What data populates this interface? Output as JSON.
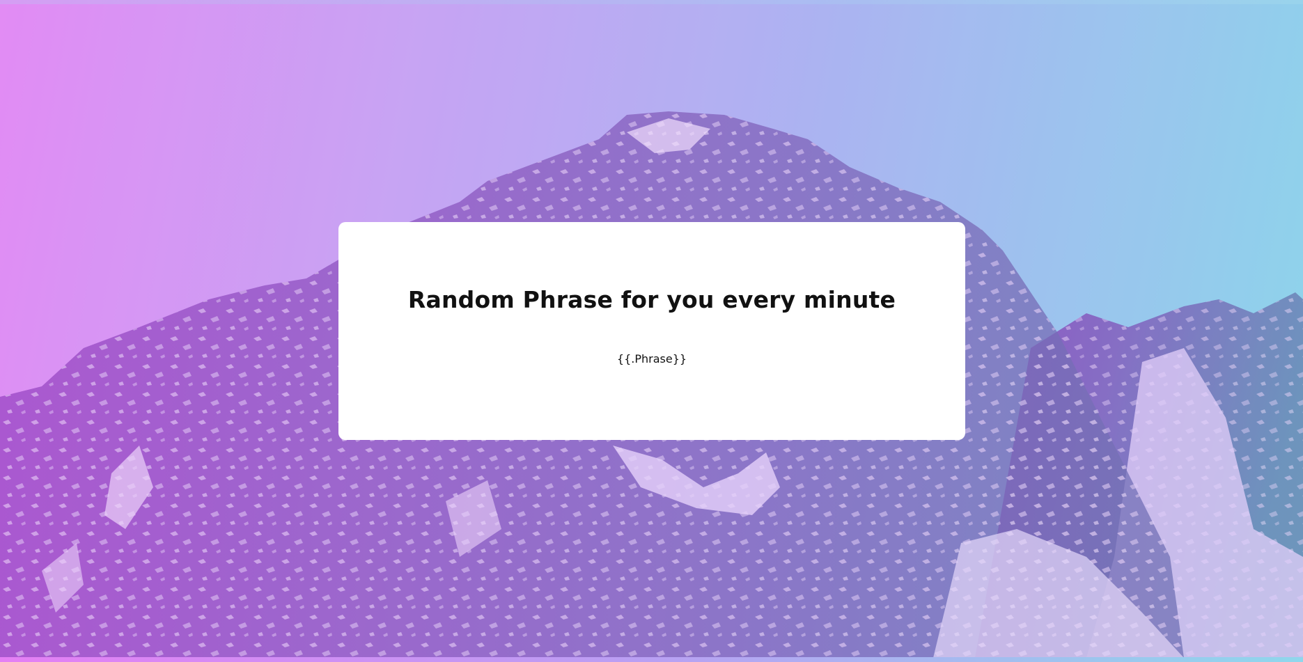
{
  "colors": {
    "gradient_left": "#e48cf5",
    "gradient_mid": "#b8b0f3",
    "gradient_right": "#86dcea",
    "card_background": "#ffffff",
    "text": "#111111"
  },
  "background": {
    "image": "snowy-mountain-photo"
  },
  "card": {
    "title": "Random Phrase for you every minute",
    "phrase": "{{.Phrase}}"
  }
}
